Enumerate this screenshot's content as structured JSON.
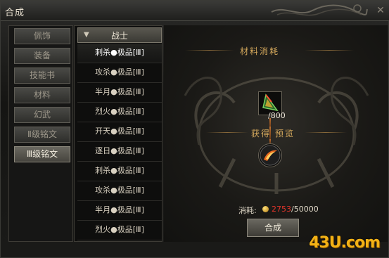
{
  "window": {
    "title": "合成"
  },
  "categories": [
    {
      "label": "佩饰",
      "active": false
    },
    {
      "label": "装备",
      "active": false
    },
    {
      "label": "技能书",
      "active": false
    },
    {
      "label": "材料",
      "active": false
    },
    {
      "label": "幻武",
      "active": false
    },
    {
      "label": "Ⅱ级铭文",
      "active": false
    },
    {
      "label": "Ⅲ级铭文",
      "active": true
    }
  ],
  "list": {
    "header": "战士",
    "items": [
      {
        "label": "刺杀●极品[Ⅲ]",
        "selected": true
      },
      {
        "label": "攻杀●极品[Ⅲ]",
        "selected": false
      },
      {
        "label": "半月●极品[Ⅲ]",
        "selected": false
      },
      {
        "label": "烈火●极品[Ⅲ]",
        "selected": false
      },
      {
        "label": "开天●极品[Ⅲ]",
        "selected": false
      },
      {
        "label": "逐日●极品[Ⅲ]",
        "selected": false
      },
      {
        "label": "刺杀●极品[Ⅲ]",
        "selected": false
      },
      {
        "label": "攻杀●极品[Ⅲ]",
        "selected": false
      },
      {
        "label": "半月●极品[Ⅲ]",
        "selected": false
      },
      {
        "label": "烈火●极品[Ⅲ]",
        "selected": false
      }
    ]
  },
  "materials": {
    "title": "材料消耗",
    "item_icon": "triangle-rune-icon",
    "count": "/800"
  },
  "result": {
    "title": "获得",
    "preview_label": "预览",
    "item_icon": "flame-slash-icon"
  },
  "cost": {
    "label": "消耗:",
    "have": "2753",
    "need": "/50000",
    "coin_icon": "gold-coin-icon"
  },
  "actions": {
    "compose_label": "合成"
  },
  "watermark": "43U.com",
  "colors": {
    "accent_gold": "#d4a85c",
    "cost_red": "#e0342a"
  }
}
